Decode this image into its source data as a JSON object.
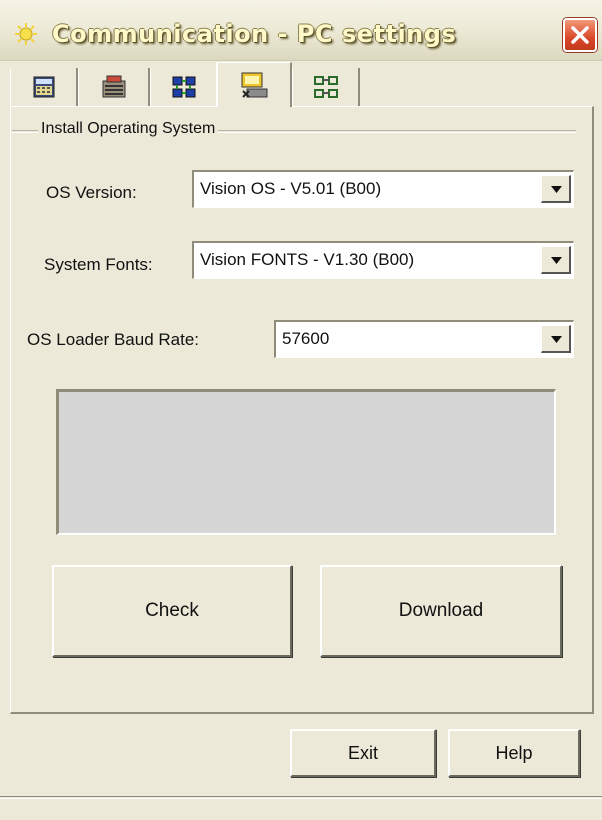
{
  "window": {
    "title": "Communication - PC settings",
    "close_icon": "close-icon"
  },
  "tabs": [
    {
      "icon": "calculator-icon",
      "active": false
    },
    {
      "icon": "plc-device-icon",
      "active": false
    },
    {
      "icon": "network-grid-icon",
      "active": false
    },
    {
      "icon": "os-download-icon",
      "active": true
    },
    {
      "icon": "network-nodes-icon",
      "active": false
    }
  ],
  "group": {
    "label": "Install Operating System"
  },
  "fields": {
    "os_version": {
      "label": "OS Version:",
      "value": "Vision OS - V5.01 (B00)"
    },
    "system_fonts": {
      "label": "System Fonts:",
      "value": "Vision FONTS - V1.30 (B00)"
    },
    "baud_rate": {
      "label": "OS Loader Baud Rate:",
      "value": "57600"
    }
  },
  "buttons": {
    "check": "Check",
    "download": "Download",
    "exit": "Exit",
    "help": "Help"
  },
  "colors": {
    "window_bg": "#ece9d8",
    "status_box_bg": "#d6d6d6",
    "close_red": "#d9472a",
    "title_text": "#fff8c8"
  }
}
